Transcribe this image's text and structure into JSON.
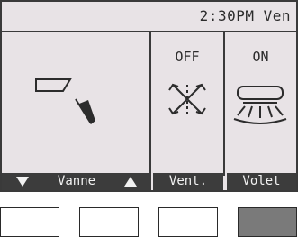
{
  "status": {
    "clock": "2:30PM Ven"
  },
  "panels": {
    "vane": {
      "icon": "vane-angle-icon"
    },
    "fan": {
      "state": "OFF",
      "icon": "swing-fan-icon"
    },
    "louver": {
      "state": "ON",
      "icon": "louver-icon"
    }
  },
  "softkeys": {
    "vane": {
      "label": "Vanne",
      "left_icon": "triangle-down-icon",
      "right_icon": "triangle-up-icon"
    },
    "fan": {
      "label": "Vent."
    },
    "louver": {
      "label": "Volet"
    }
  },
  "buttons": [
    {
      "name": "function-button-1",
      "active": false
    },
    {
      "name": "function-button-2",
      "active": false
    },
    {
      "name": "function-button-3",
      "active": false
    },
    {
      "name": "function-button-4",
      "active": true
    }
  ],
  "colors": {
    "lcd_background": "#e8e3e6",
    "softkey_background": "#3c3c3c",
    "active_button": "#7a7a7a"
  }
}
